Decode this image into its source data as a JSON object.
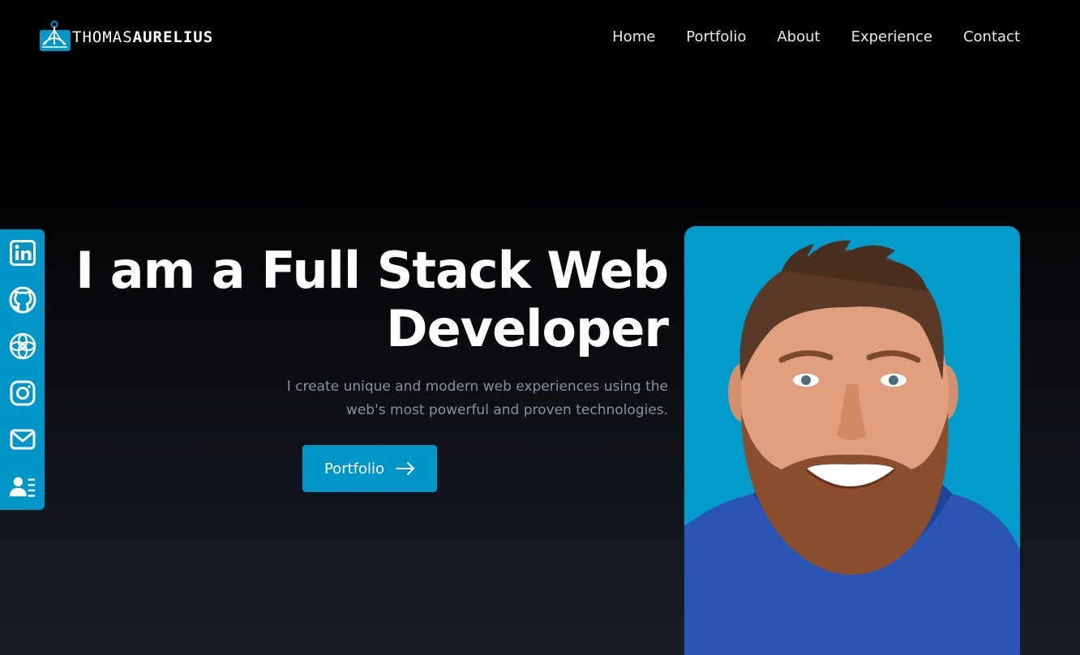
{
  "header": {
    "logo_text_thin": "THOMAS",
    "logo_text_bold": "AURELIUS",
    "nav": [
      {
        "label": "Home"
      },
      {
        "label": "Portfolio"
      },
      {
        "label": "About"
      },
      {
        "label": "Experience"
      },
      {
        "label": "Contact"
      }
    ]
  },
  "social": {
    "icons": [
      "linkedin-icon",
      "github-icon",
      "sololearn-icon",
      "instagram-icon",
      "mail-icon",
      "contact-card-icon"
    ]
  },
  "hero": {
    "title_line1": "I am a Full Stack Web",
    "title_line2": "Developer",
    "subtitle_line1": "I create unique and modern web experiences using the",
    "subtitle_line2": "web's most powerful and proven technologies.",
    "cta_label": "Portfolio"
  },
  "colors": {
    "accent": "#0096c7",
    "portrait_bg": "#019ccb",
    "subtitle": "#8a8f9e"
  }
}
